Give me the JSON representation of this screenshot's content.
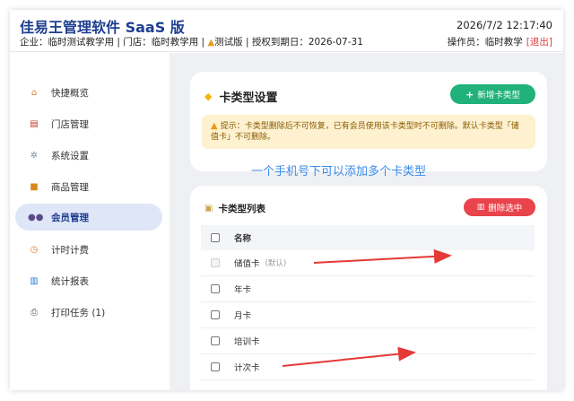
{
  "header": {
    "app_title": "佳易王管理软件 SaaS 版",
    "info_prefix": "企业：临时测试教学用 | 门店：临时教学用 | ",
    "trial_label": "测试版",
    "info_suffix": " | 授权到期日：2026-07-31",
    "datetime": "2026/7/2 12:17:40",
    "operator": "操作员：临时教学",
    "logout": "[退出]"
  },
  "sidebar": {
    "items": [
      {
        "label": "快捷概览",
        "icon": "home-icon",
        "active": false
      },
      {
        "label": "门店管理",
        "icon": "store-icon",
        "active": false
      },
      {
        "label": "系统设置",
        "icon": "gear-icon",
        "active": false
      },
      {
        "label": "商品管理",
        "icon": "box-icon",
        "active": false
      },
      {
        "label": "会员管理",
        "icon": "users-icon",
        "active": true
      },
      {
        "label": "计时计费",
        "icon": "timer-icon",
        "active": false
      },
      {
        "label": "统计报表",
        "icon": "chart-icon",
        "active": false
      },
      {
        "label": "打印任务 (1)",
        "icon": "printer-icon",
        "active": false
      }
    ]
  },
  "card_settings": {
    "title": "卡类型设置",
    "add_button": "新增卡类型",
    "notice": "提示：卡类型删除后不可恢复，已有会员使用该卡类型时不可删除。默认卡类型「储值卡」不可删除。"
  },
  "overlay_text": "一个手机号下可以添加多个卡类型",
  "card_list": {
    "title": "卡类型列表",
    "delete_button": "删除选中",
    "column_name": "名称",
    "rows": [
      {
        "name": "储值卡",
        "tag": "(默认)"
      },
      {
        "name": "年卡",
        "tag": ""
      },
      {
        "name": "月卡",
        "tag": ""
      },
      {
        "name": "培训卡",
        "tag": ""
      },
      {
        "name": "计次卡",
        "tag": ""
      }
    ]
  },
  "colors": {
    "brand": "#1f3f8f",
    "green": "#20b27a",
    "red": "#e9434b",
    "annotation_arrow": "#e53935",
    "overlay_text": "#3b8be8"
  }
}
